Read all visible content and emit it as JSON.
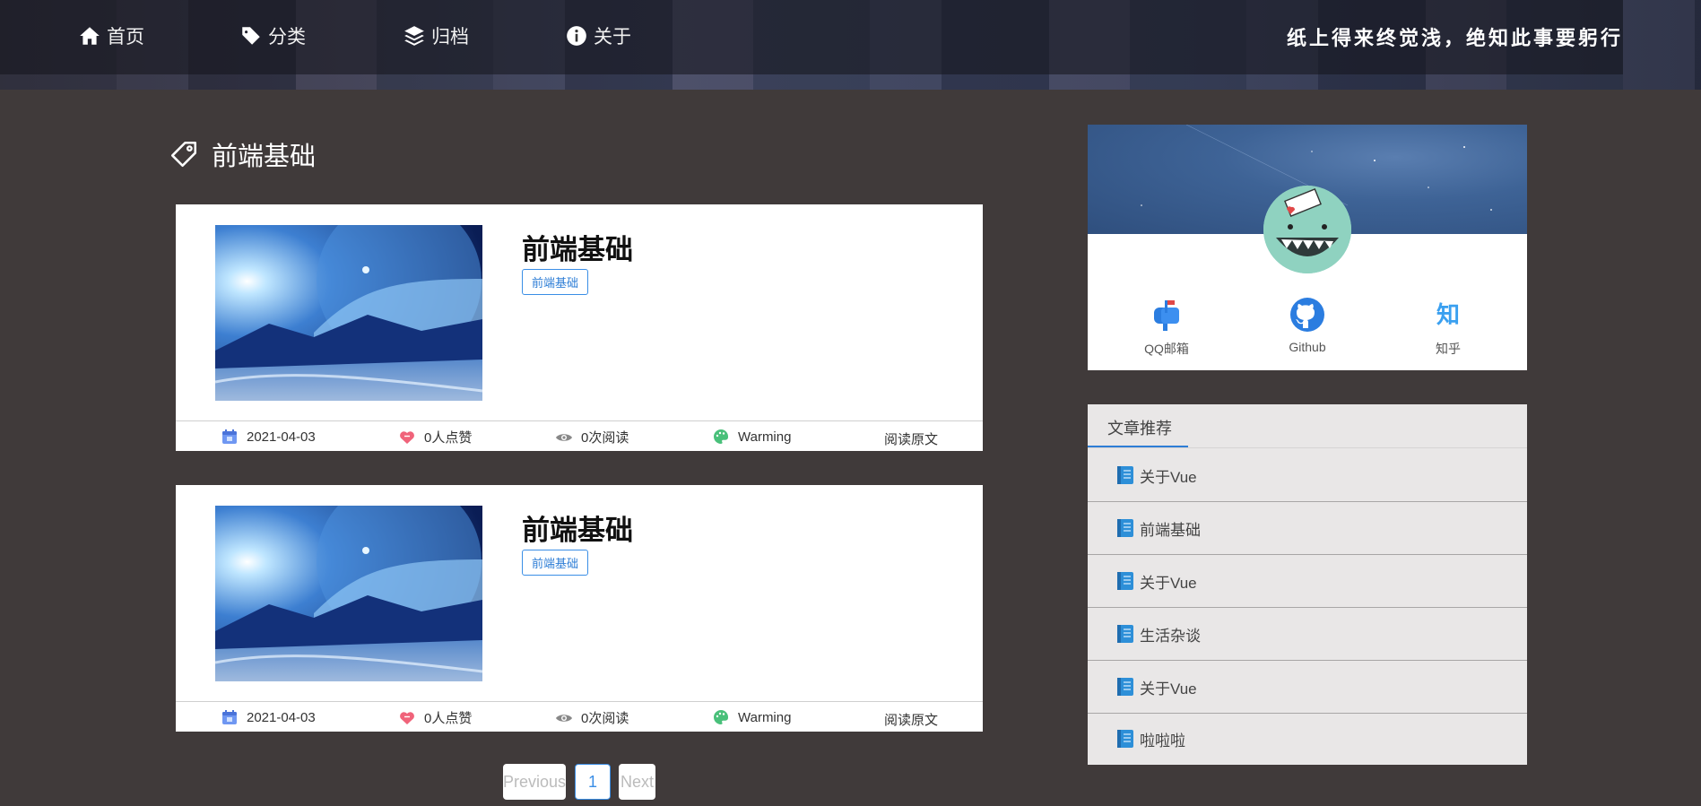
{
  "nav": {
    "home": "首页",
    "category": "分类",
    "archive": "归档",
    "about": "关于",
    "motto": "纸上得来终觉浅，绝知此事要躬行"
  },
  "category_title": "前端基础",
  "articles": [
    {
      "title": "前端基础",
      "tag": "前端基础",
      "date": "2021-04-03",
      "likes": "0人点赞",
      "views": "0次阅读",
      "theme": "Warming",
      "read_more": "阅读原文"
    },
    {
      "title": "前端基础",
      "tag": "前端基础",
      "date": "2021-04-03",
      "likes": "0人点赞",
      "views": "0次阅读",
      "theme": "Warming",
      "read_more": "阅读原文"
    }
  ],
  "pagination": {
    "previous": "Previous",
    "current": "1",
    "next": "Next"
  },
  "profile": {
    "socials": [
      {
        "label": "QQ邮箱",
        "icon": "mailbox-icon"
      },
      {
        "label": "Github",
        "icon": "github-icon"
      },
      {
        "label": "知乎",
        "icon": "zhihu-icon"
      }
    ]
  },
  "recommend": {
    "title": "文章推荐",
    "items": [
      "关于Vue",
      "前端基础",
      "关于Vue",
      "生活杂谈",
      "关于Vue",
      "啦啦啦"
    ]
  },
  "colors": {
    "page_bg": "#403a3a",
    "accent": "#2e7ed6",
    "card_bg": "#ffffff",
    "recommend_bg": "#e9e7e7"
  }
}
